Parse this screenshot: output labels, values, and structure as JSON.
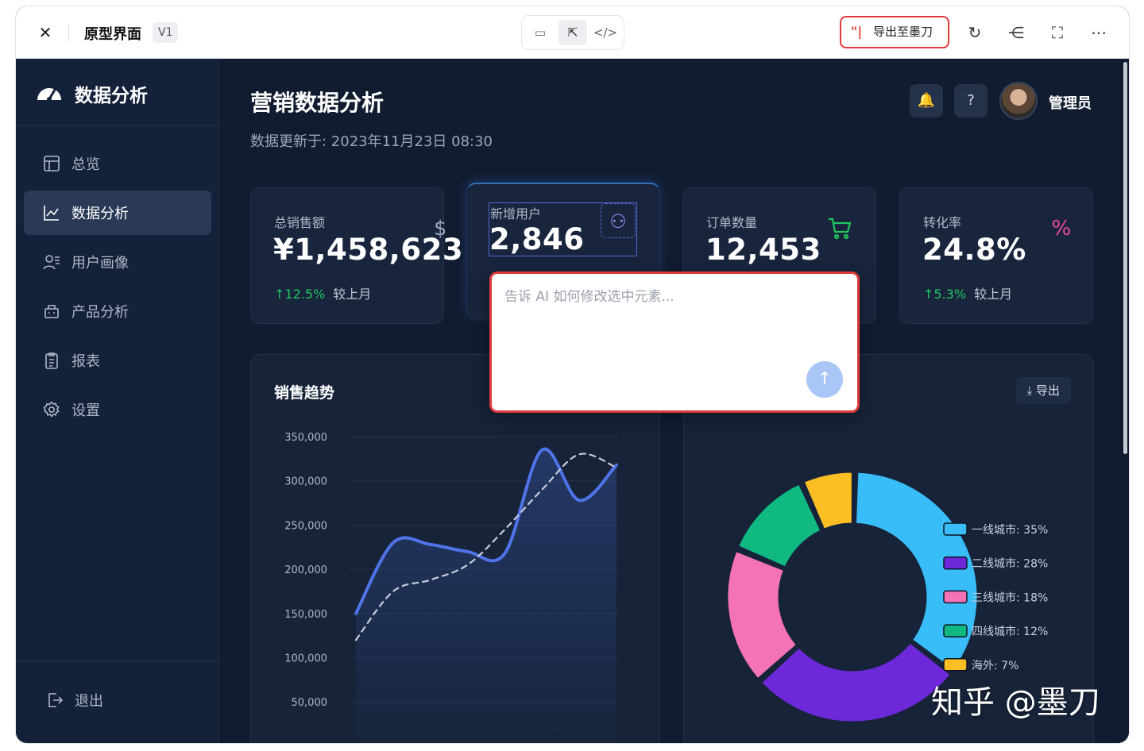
{
  "topbar": {
    "title": "原型界面",
    "version": "V1",
    "export_label": "导出至墨刀",
    "export_logo": "\"|",
    "modes": [
      "preview-icon",
      "select-icon",
      "code-icon"
    ]
  },
  "sidebar": {
    "brand": "数据分析",
    "items": [
      {
        "label": "总览",
        "icon": "overview-icon"
      },
      {
        "label": "数据分析",
        "icon": "chart-line-icon",
        "active": true
      },
      {
        "label": "用户画像",
        "icon": "user-profile-icon"
      },
      {
        "label": "产品分析",
        "icon": "product-icon"
      },
      {
        "label": "报表",
        "icon": "clipboard-icon"
      },
      {
        "label": "设置",
        "icon": "gear-icon"
      }
    ],
    "logout": "退出"
  },
  "header": {
    "title": "营销数据分析",
    "updated": "数据更新于: 2023年11月23日 08:30",
    "user": "管理员"
  },
  "cards": [
    {
      "label": "总销售额",
      "value": "¥1,458,623",
      "trend": "↑12.5%",
      "trend_text": "较上月",
      "icon_glyph": "$",
      "icon_color": "#9aa6ba"
    },
    {
      "label": "新增用户",
      "value": "2,846",
      "icon_glyph": "⚇",
      "icon_color": "#a78bfa"
    },
    {
      "label": "订单数量",
      "value": "12,453",
      "icon_glyph": "🛒",
      "icon_color": "#22c55e"
    },
    {
      "label": "转化率",
      "value": "24.8%",
      "trend": "↑5.3%",
      "trend_text": "较上月",
      "icon_glyph": "%",
      "icon_color": "#ec4899"
    }
  ],
  "panels": {
    "trend_title": "销售趋势",
    "export_label": "导出"
  },
  "ai_prompt": {
    "placeholder": "告诉 AI 如何修改选中元素...",
    "send_glyph": "↑"
  },
  "watermark": "知乎 @墨刀",
  "chart_data": [
    {
      "type": "line",
      "title": "销售趋势",
      "yticks": [
        "350,000",
        "300,000",
        "250,000",
        "200,000",
        "150,000",
        "100,000",
        "50,000"
      ],
      "ylim": [
        0,
        350000
      ],
      "series": [
        {
          "style": "solid",
          "color": "#4f73e8",
          "values": [
            150000,
            230000,
            228000,
            220000,
            218000,
            335000,
            278000,
            318000
          ]
        },
        {
          "style": "dashed",
          "color": "#c7cdd8",
          "values": [
            120000,
            175000,
            188000,
            205000,
            245000,
            290000,
            330000,
            315000
          ]
        }
      ]
    },
    {
      "type": "pie",
      "donut": true,
      "slices": [
        {
          "label": "一线城市: 35%",
          "value": 35,
          "color": "#38bdf8"
        },
        {
          "label": "二线城市: 28%",
          "value": 28,
          "color": "#6d28d9"
        },
        {
          "label": "三线城市: 18%",
          "value": 18,
          "color": "#f472b6"
        },
        {
          "label": "四线城市: 12%",
          "value": 12,
          "color": "#10b981"
        },
        {
          "label": "海外: 7%",
          "value": 7,
          "color": "#fbbf24"
        }
      ]
    }
  ]
}
